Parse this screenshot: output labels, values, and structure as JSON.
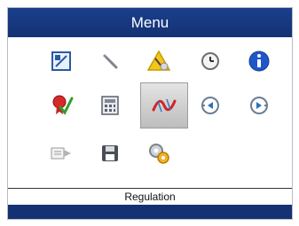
{
  "menu": {
    "title": "Menu",
    "selected_label": "Regulation",
    "accent_color": "#143273",
    "icons": [
      {
        "name": "display-icon",
        "selected": false
      },
      {
        "name": "wrench-icon",
        "selected": false
      },
      {
        "name": "warning-icon",
        "selected": false
      },
      {
        "name": "clock-icon",
        "selected": false
      },
      {
        "name": "info-icon",
        "selected": false
      },
      {
        "name": "certificate-icon",
        "selected": false
      },
      {
        "name": "calculator-icon",
        "selected": false
      },
      {
        "name": "regulation-curve-icon",
        "selected": true
      },
      {
        "name": "left-arrow-circle-icon",
        "selected": false
      },
      {
        "name": "right-arrow-circle-icon",
        "selected": false
      },
      {
        "name": "export-icon",
        "selected": false
      },
      {
        "name": "save-disk-icon",
        "selected": false
      },
      {
        "name": "settings-gears-icon",
        "selected": false
      }
    ]
  }
}
